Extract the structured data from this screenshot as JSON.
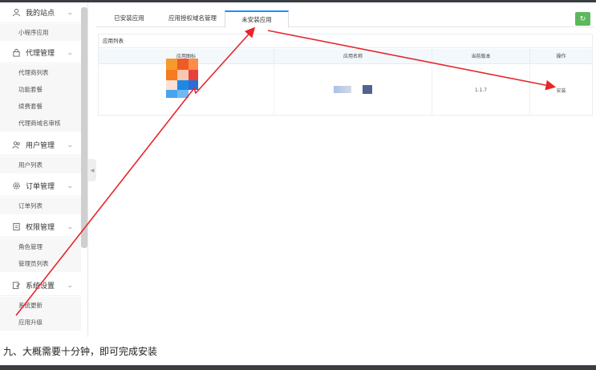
{
  "sidebar": {
    "groups": [
      {
        "label": "我的站点",
        "icon": "person-icon",
        "items": [
          "小程序应用"
        ]
      },
      {
        "label": "代理管理",
        "icon": "lock-icon",
        "items": [
          "代理商列表",
          "功能套餐",
          "续费套餐",
          "代理商域名审核"
        ]
      },
      {
        "label": "用户管理",
        "icon": "users-icon",
        "items": [
          "用户列表"
        ]
      },
      {
        "label": "订单管理",
        "icon": "gear-icon",
        "items": [
          "订单列表"
        ]
      },
      {
        "label": "权限管理",
        "icon": "list-icon",
        "items": [
          "角色管理",
          "管理员列表"
        ]
      },
      {
        "label": "系统设置",
        "icon": "edit-icon",
        "items": [
          "系统更新",
          "应用升级"
        ]
      }
    ]
  },
  "tabs": [
    "已安装应用",
    "应用授权域名管理",
    "未安装应用"
  ],
  "active_tab": 2,
  "panel": {
    "title": "应用列表",
    "columns": [
      "应用图标",
      "应用名称",
      "当前版本",
      "操作"
    ],
    "rows": [
      {
        "version": "1.1.7",
        "action": "安装"
      }
    ]
  },
  "caption": "九、大概需要十分钟，即可完成安装",
  "colors": {
    "accent": "#1890ff",
    "refresh": "#5cb85c",
    "arrow": "#e8262b"
  }
}
